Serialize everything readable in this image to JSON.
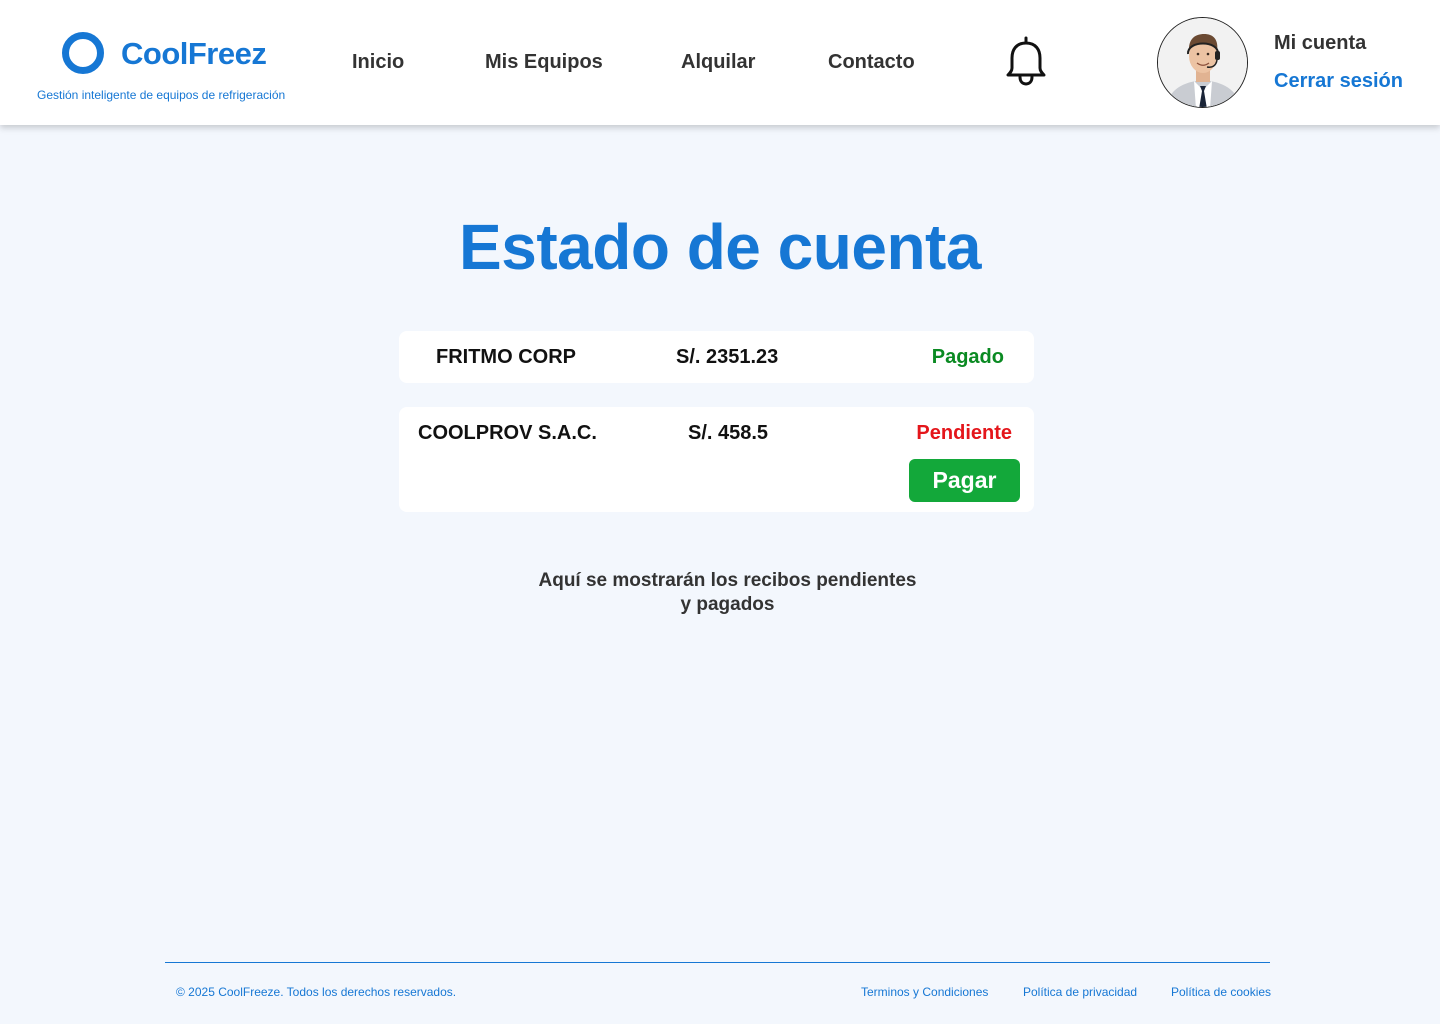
{
  "colors": {
    "brand_blue": "#1677d4",
    "background": "#f3f7fd",
    "paid_green": "#0a8a22",
    "pending_red": "#e4161b",
    "pay_button": "#13a83a"
  },
  "header": {
    "logo": {
      "name": "CoolFreez",
      "tagline": "Gestión inteligente de equipos de refrigeración",
      "icon": "ring-logo-icon"
    },
    "nav": [
      {
        "label": "Inicio"
      },
      {
        "label": "Mis Equipos"
      },
      {
        "label": "Alquilar"
      },
      {
        "label": "Contacto"
      }
    ],
    "notifications_icon": "bell-icon",
    "account": {
      "avatar": "user-avatar-photo",
      "my_account_label": "Mi cuenta",
      "logout_label": "Cerrar sesión"
    }
  },
  "main": {
    "title": "Estado de cuenta",
    "receipts": [
      {
        "company": "FRITMO CORP",
        "amount": "S/. 2351.23",
        "status": "Pagado"
      },
      {
        "company": "COOLPROV S.A.C.",
        "amount": "S/. 458.5",
        "status": "Pendiente",
        "action_label": "Pagar"
      }
    ],
    "info_line1": "Aquí se mostrarán los recibos pendientes",
    "info_line2": "y pagados"
  },
  "footer": {
    "copyright": "© 2025 CoolFreeze. Todos los derechos reservados.",
    "links": [
      {
        "label": "Terminos y Condiciones"
      },
      {
        "label": "Política de privacidad"
      },
      {
        "label": "Política de cookies"
      }
    ]
  }
}
